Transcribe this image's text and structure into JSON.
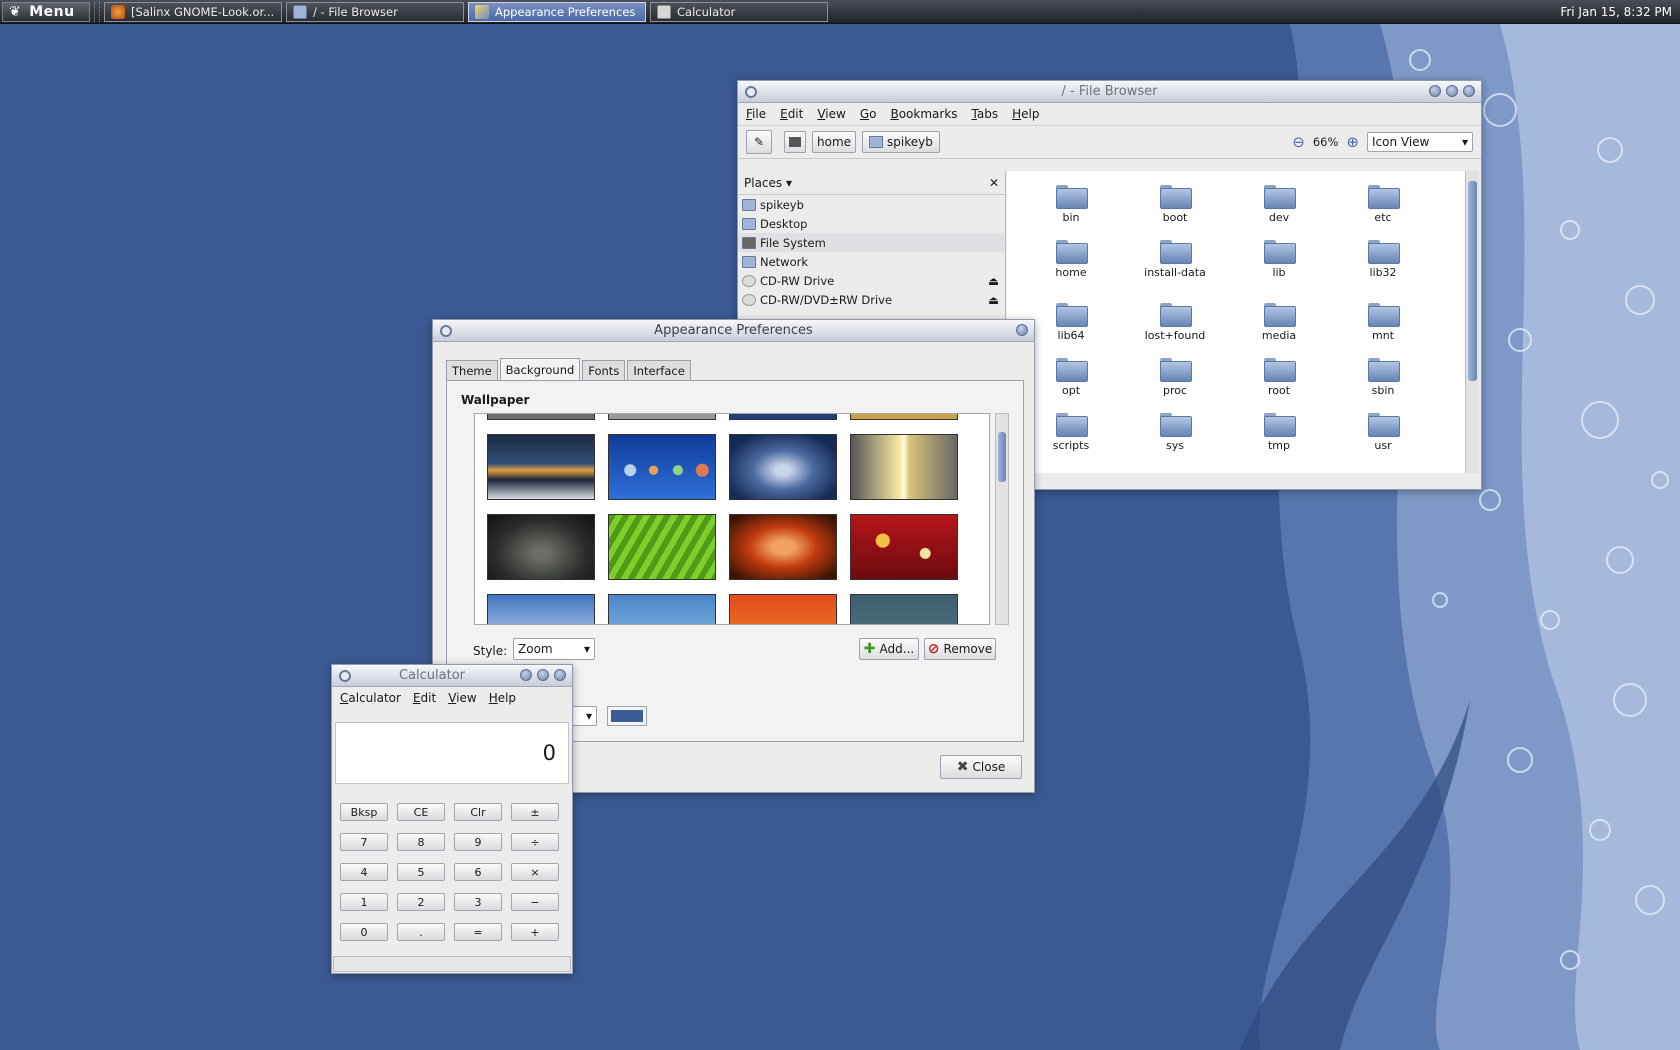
{
  "colors": {
    "desktop": "#3b5a93",
    "accent": "#4a6aa8",
    "window_bg": "#ececec",
    "bg_color_swatch": "#3d5c95"
  },
  "panel": {
    "menu_label": "Menu",
    "tasks": [
      {
        "label": "[Salinx GNOME-Look.or...",
        "icon": "firefox-icon"
      },
      {
        "label": "/ - File Browser",
        "icon": "folder-icon"
      },
      {
        "label": "Appearance Preferences",
        "icon": "appearance-icon",
        "active": true
      },
      {
        "label": "Calculator",
        "icon": "calculator-icon"
      }
    ],
    "clock": "Fri Jan 15,  8:32 PM"
  },
  "file_browser": {
    "title": "/ - File Browser",
    "menu": [
      "File",
      "Edit",
      "View",
      "Go",
      "Bookmarks",
      "Tabs",
      "Help"
    ],
    "path": [
      "home",
      "spikeyb"
    ],
    "zoom": "66%",
    "view_mode": "Icon View",
    "sidebar_title": "Places",
    "places": [
      "spikeyb",
      "Desktop",
      "File System",
      "Network",
      "CD-RW Drive",
      "CD-RW/DVD±RW Drive"
    ],
    "folders": [
      "bin",
      "boot",
      "dev",
      "etc",
      "home",
      "install-data",
      "lib",
      "lib32",
      "lib64",
      "lost+found",
      "media",
      "mnt",
      "opt",
      "proc",
      "root",
      "sbin",
      "scripts",
      "sys",
      "tmp",
      "usr"
    ]
  },
  "appearance": {
    "title": "Appearance Preferences",
    "tabs": [
      "Theme",
      "Background",
      "Fonts",
      "Interface"
    ],
    "section": "Wallpaper",
    "style_label": "Style:",
    "style_value": "Zoom",
    "add_label": "Add...",
    "remove_label": "Remove",
    "close_label": "Close"
  },
  "calculator": {
    "title": "Calculator",
    "menu": [
      "Calculator",
      "Edit",
      "View",
      "Help"
    ],
    "display": "0",
    "keys": [
      "Bksp",
      "CE",
      "Clr",
      "±",
      "7",
      "8",
      "9",
      "÷",
      "4",
      "5",
      "6",
      "×",
      "1",
      "2",
      "3",
      "−",
      "0",
      ".",
      "=",
      "+"
    ]
  }
}
